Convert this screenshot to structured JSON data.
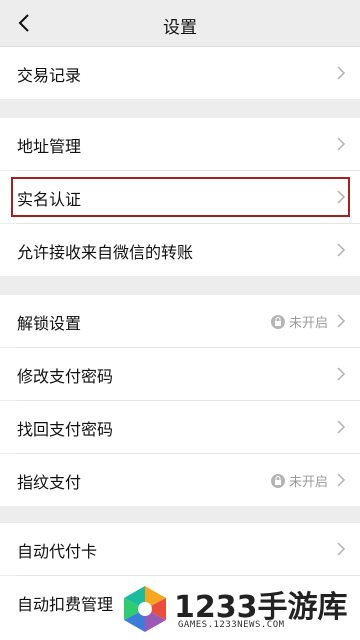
{
  "header": {
    "title": "设置"
  },
  "groups": [
    {
      "items": [
        {
          "label": "交易记录"
        }
      ]
    },
    {
      "items": [
        {
          "label": "地址管理"
        },
        {
          "label": "实名认证"
        },
        {
          "label": "允许接收来自微信的转账"
        }
      ]
    },
    {
      "items": [
        {
          "label": "解锁设置",
          "status": "未开启"
        },
        {
          "label": "修改支付密码"
        },
        {
          "label": "找回支付密码"
        },
        {
          "label": "指纹支付",
          "status": "未开启"
        }
      ]
    },
    {
      "items": [
        {
          "label": "自动代付卡"
        },
        {
          "label": "自动扣费管理"
        }
      ]
    }
  ],
  "watermark": {
    "brand_text": "1233手游库",
    "site_text": "GAMES.1233NEWS.COM"
  },
  "colors": {
    "highlight": "#a52121",
    "background": "#ededed",
    "row": "#ffffff"
  }
}
